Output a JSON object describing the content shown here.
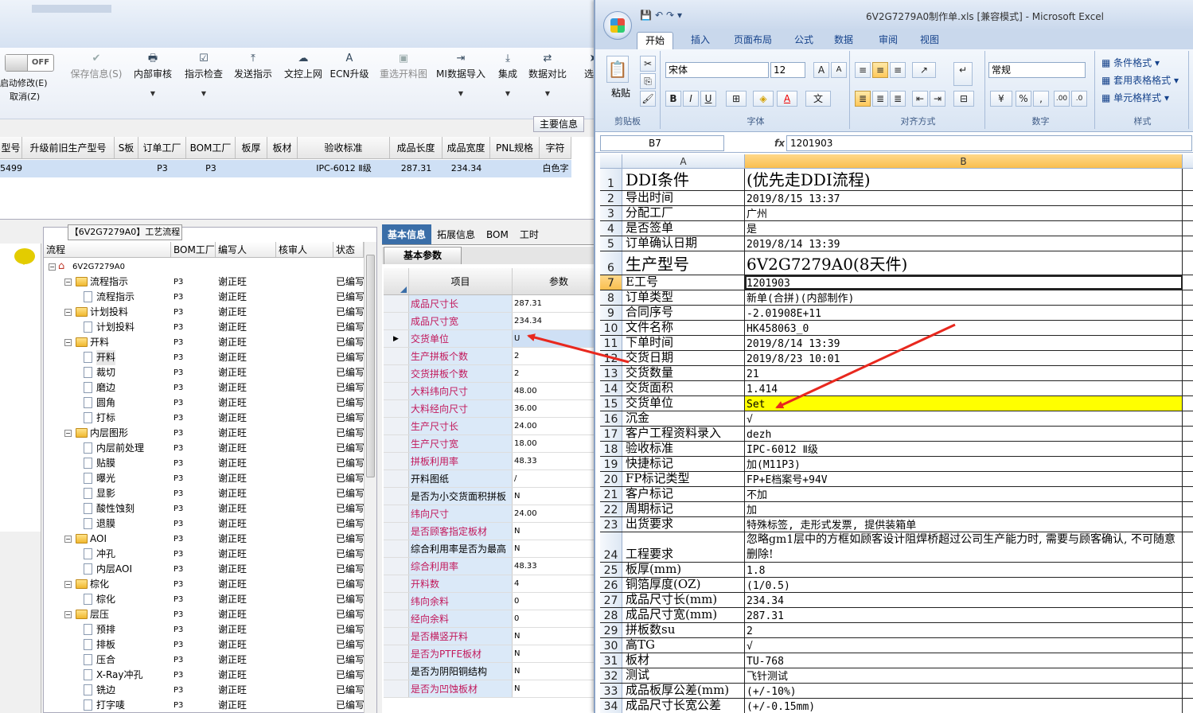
{
  "mes": {
    "toggle_label": "OFF",
    "start_modify": "启动修改(E)",
    "cancel": "取消(Z)",
    "toolbar": [
      {
        "label": "保存信息(S)",
        "icon": "check-icon",
        "disabled": true,
        "dd": false
      },
      {
        "label": "内部审核",
        "icon": "printer-icon",
        "disabled": false,
        "dd": true
      },
      {
        "label": "指示检查",
        "icon": "checkbox-icon",
        "disabled": false,
        "dd": true
      },
      {
        "label": "发送指示",
        "icon": "upload-icon",
        "disabled": false,
        "dd": false
      },
      {
        "label": "文控上网",
        "icon": "cloud-upload-icon",
        "disabled": false,
        "dd": false
      },
      {
        "label": "ECN升级",
        "icon": "a-letter-icon",
        "disabled": false,
        "dd": false
      },
      {
        "label": "重选开料图",
        "icon": "image-icon",
        "disabled": true,
        "dd": false
      },
      {
        "label": "MI数据导入",
        "icon": "import-icon",
        "disabled": false,
        "dd": true
      },
      {
        "label": "集成",
        "icon": "download-icon",
        "disabled": false,
        "dd": true
      },
      {
        "label": "数据对比",
        "icon": "compare-icon",
        "disabled": false,
        "dd": true
      },
      {
        "label": "选择",
        "icon": "arrow-icon",
        "disabled": false,
        "dd": false
      }
    ],
    "main_info_button": "主要信息",
    "grid_headers": [
      "型号",
      "升级前旧生产型号",
      "S板",
      "订单工厂",
      "BOM工厂",
      "板厚",
      "板材",
      "验收标准",
      "成品长度",
      "成品宽度",
      "PNL规格",
      "字符"
    ],
    "grid_row": [
      "5499",
      "",
      "",
      "P3",
      "P3",
      "",
      "",
      "IPC-6012 Ⅱ级",
      "287.31",
      "234.34",
      "",
      "白色字"
    ],
    "tree_title": "【6V2G7279A0】工艺流程",
    "tree_headers": [
      "流程",
      "BOM工厂",
      "编写人",
      "核审人",
      "状态"
    ],
    "tree_rows": [
      {
        "level": 0,
        "type": "home",
        "label": "6V2G7279A0",
        "factory": "",
        "author": "",
        "status": ""
      },
      {
        "level": 1,
        "type": "folder",
        "label": "流程指示",
        "factory": "P3",
        "author": "谢正旺",
        "status": "已编写"
      },
      {
        "level": 2,
        "type": "doc",
        "label": "流程指示",
        "factory": "P3",
        "author": "谢正旺",
        "status": "已编写"
      },
      {
        "level": 1,
        "type": "folder",
        "label": "计划投料",
        "factory": "P3",
        "author": "谢正旺",
        "status": "已编写"
      },
      {
        "level": 2,
        "type": "doc",
        "label": "计划投料",
        "factory": "P3",
        "author": "谢正旺",
        "status": "已编写"
      },
      {
        "level": 1,
        "type": "folder",
        "label": "开料",
        "factory": "P3",
        "author": "谢正旺",
        "status": "已编写"
      },
      {
        "level": 2,
        "type": "doc",
        "label": "开料",
        "factory": "P3",
        "author": "谢正旺",
        "status": "已编写",
        "selected": true
      },
      {
        "level": 2,
        "type": "doc",
        "label": "裁切",
        "factory": "P3",
        "author": "谢正旺",
        "status": "已编写"
      },
      {
        "level": 2,
        "type": "doc",
        "label": "磨边",
        "factory": "P3",
        "author": "谢正旺",
        "status": "已编写"
      },
      {
        "level": 2,
        "type": "doc",
        "label": "圆角",
        "factory": "P3",
        "author": "谢正旺",
        "status": "已编写"
      },
      {
        "level": 2,
        "type": "doc",
        "label": "打标",
        "factory": "P3",
        "author": "谢正旺",
        "status": "已编写"
      },
      {
        "level": 1,
        "type": "folder",
        "label": "内层图形",
        "factory": "P3",
        "author": "谢正旺",
        "status": "已编写"
      },
      {
        "level": 2,
        "type": "doc",
        "label": "内层前处理",
        "factory": "P3",
        "author": "谢正旺",
        "status": "已编写"
      },
      {
        "level": 2,
        "type": "doc",
        "label": "贴膜",
        "factory": "P3",
        "author": "谢正旺",
        "status": "已编写"
      },
      {
        "level": 2,
        "type": "doc",
        "label": "曝光",
        "factory": "P3",
        "author": "谢正旺",
        "status": "已编写"
      },
      {
        "level": 2,
        "type": "doc",
        "label": "显影",
        "factory": "P3",
        "author": "谢正旺",
        "status": "已编写"
      },
      {
        "level": 2,
        "type": "doc",
        "label": "酸性蚀刻",
        "factory": "P3",
        "author": "谢正旺",
        "status": "已编写"
      },
      {
        "level": 2,
        "type": "doc",
        "label": "退膜",
        "factory": "P3",
        "author": "谢正旺",
        "status": "已编写"
      },
      {
        "level": 1,
        "type": "folder",
        "label": "AOI",
        "factory": "P3",
        "author": "谢正旺",
        "status": "已编写"
      },
      {
        "level": 2,
        "type": "doc",
        "label": "冲孔",
        "factory": "P3",
        "author": "谢正旺",
        "status": "已编写"
      },
      {
        "level": 2,
        "type": "doc",
        "label": "内层AOI",
        "factory": "P3",
        "author": "谢正旺",
        "status": "已编写"
      },
      {
        "level": 1,
        "type": "folder",
        "label": "棕化",
        "factory": "P3",
        "author": "谢正旺",
        "status": "已编写"
      },
      {
        "level": 2,
        "type": "doc",
        "label": "棕化",
        "factory": "P3",
        "author": "谢正旺",
        "status": "已编写"
      },
      {
        "level": 1,
        "type": "folder",
        "label": "层压",
        "factory": "P3",
        "author": "谢正旺",
        "status": "已编写"
      },
      {
        "level": 2,
        "type": "doc",
        "label": "预排",
        "factory": "P3",
        "author": "谢正旺",
        "status": "已编写"
      },
      {
        "level": 2,
        "type": "doc",
        "label": "排板",
        "factory": "P3",
        "author": "谢正旺",
        "status": "已编写"
      },
      {
        "level": 2,
        "type": "doc",
        "label": "压合",
        "factory": "P3",
        "author": "谢正旺",
        "status": "已编写"
      },
      {
        "level": 2,
        "type": "doc",
        "label": "X-Ray冲孔",
        "factory": "P3",
        "author": "谢正旺",
        "status": "已编写"
      },
      {
        "level": 2,
        "type": "doc",
        "label": "铣边",
        "factory": "P3",
        "author": "谢正旺",
        "status": "已编写"
      },
      {
        "level": 2,
        "type": "doc",
        "label": "打字唛",
        "factory": "P3",
        "author": "谢正旺",
        "status": "已编写"
      }
    ],
    "param_tabs": [
      "基本信息",
      "拓展信息",
      "BOM",
      "工时"
    ],
    "param_subtab": "基本参数",
    "param_headers": {
      "name": "项目",
      "value": "参数"
    },
    "params": [
      {
        "name": "成品尺寸长",
        "value": "287.31",
        "mandatory": true
      },
      {
        "name": "成品尺寸宽",
        "value": "234.34",
        "mandatory": true
      },
      {
        "name": "交货单位",
        "value": "U",
        "mandatory": true,
        "current": true
      },
      {
        "name": "生产拼板个数",
        "value": "2",
        "mandatory": true
      },
      {
        "name": "交货拼板个数",
        "value": "2",
        "mandatory": true
      },
      {
        "name": "大料纬向尺寸",
        "value": "48.00",
        "mandatory": true
      },
      {
        "name": "大料经向尺寸",
        "value": "36.00",
        "mandatory": true
      },
      {
        "name": "生产尺寸长",
        "value": "24.00",
        "mandatory": true
      },
      {
        "name": "生产尺寸宽",
        "value": "18.00",
        "mandatory": true
      },
      {
        "name": "拼板利用率",
        "value": "48.33",
        "mandatory": true
      },
      {
        "name": "开料图纸",
        "value": "/",
        "mandatory": false
      },
      {
        "name": "是否为小交货面积拼板",
        "value": "N",
        "mandatory": false
      },
      {
        "name": "纬向尺寸",
        "value": "24.00",
        "mandatory": true
      },
      {
        "name": "是否顾客指定板材",
        "value": "N",
        "mandatory": true
      },
      {
        "name": "综合利用率是否为最高",
        "value": "N",
        "mandatory": false
      },
      {
        "name": "综合利用率",
        "value": "48.33",
        "mandatory": true
      },
      {
        "name": "开料数",
        "value": "4",
        "mandatory": true
      },
      {
        "name": "纬向余料",
        "value": "0",
        "mandatory": true
      },
      {
        "name": "经向余料",
        "value": "0",
        "mandatory": true
      },
      {
        "name": "是否横竖开料",
        "value": "N",
        "mandatory": true
      },
      {
        "name": "是否为PTFE板材",
        "value": "N",
        "mandatory": true
      },
      {
        "name": "是否为阴阳铜结构",
        "value": "N",
        "mandatory": false
      },
      {
        "name": "是否为凹蚀板材",
        "value": "N",
        "mandatory": true
      }
    ]
  },
  "excel": {
    "title": "6V2G7279A0制作单.xls [兼容模式] - Microsoft Excel",
    "tabs": [
      "开始",
      "插入",
      "页面布局",
      "公式",
      "数据",
      "审阅",
      "视图"
    ],
    "font_name": "宋体",
    "font_size": "12",
    "number_format": "常规",
    "paste_label": "粘贴",
    "group_labels": [
      "剪贴板",
      "字体",
      "对齐方式",
      "数字",
      "样式"
    ],
    "style_buttons": [
      "条件格式",
      "套用表格格式",
      "单元格样式"
    ],
    "name_box": "B7",
    "fx": "fx",
    "formula_value": "1201903",
    "col_a": "A",
    "col_b": "B",
    "rows": [
      {
        "n": "1",
        "a": "DDI条件",
        "b": "(优先走DDI流程)",
        "big": true
      },
      {
        "n": "2",
        "a": "导出时间",
        "b": "2019/8/15 13:37"
      },
      {
        "n": "3",
        "a": "分配工厂",
        "b": "广州"
      },
      {
        "n": "4",
        "a": "是否签单",
        "b": "是"
      },
      {
        "n": "5",
        "a": "订单确认日期",
        "b": "2019/8/14 13:39"
      },
      {
        "n": "6",
        "a": "生产型号",
        "b": "6V2G7279A0(8天件)",
        "big": true
      },
      {
        "n": "7",
        "a": "E工号",
        "b": "1201903",
        "sel": true
      },
      {
        "n": "8",
        "a": "订单类型",
        "b": "新单(合拼)(内部制作)"
      },
      {
        "n": "9",
        "a": "合同序号",
        "b": "-2.01908E+11"
      },
      {
        "n": "10",
        "a": "文件名称",
        "b": "HK458063_0"
      },
      {
        "n": "11",
        "a": "下单时间",
        "b": "2019/8/14 13:39"
      },
      {
        "n": "12",
        "a": "交货日期",
        "b": "2019/8/23 10:01"
      },
      {
        "n": "13",
        "a": "交货数量",
        "b": "21"
      },
      {
        "n": "14",
        "a": "交货面积",
        "b": "1.414"
      },
      {
        "n": "15",
        "a": "交货单位",
        "b": "Set",
        "yellow": true
      },
      {
        "n": "16",
        "a": "沉金",
        "b": "√"
      },
      {
        "n": "17",
        "a": "客户工程资料录入",
        "b": "dezh"
      },
      {
        "n": "18",
        "a": "验收标准",
        "b": "IPC-6012 Ⅱ级"
      },
      {
        "n": "19",
        "a": "快捷标记",
        "b": "加(M11P3)"
      },
      {
        "n": "20",
        "a": "FP标记类型",
        "b": "FP+E档案号+94V"
      },
      {
        "n": "21",
        "a": "客户标记",
        "b": "不加"
      },
      {
        "n": "22",
        "a": "周期标记",
        "b": "加"
      },
      {
        "n": "23",
        "a": "出货要求",
        "b": "特殊标签, 走形式发票, 提供装箱单"
      },
      {
        "n": "24",
        "a": "工程要求",
        "b": "忽略gm1层中的方框如顾客设计阻焊桥超过公司生产能力时, 需要与顾客确认, 不可随意删除!",
        "wrap": true
      },
      {
        "n": "25",
        "a": "板厚(mm)",
        "b": "1.8"
      },
      {
        "n": "26",
        "a": "铜箔厚度(OZ)",
        "b": "(1/0.5)"
      },
      {
        "n": "27",
        "a": "成品尺寸长(mm)",
        "b": "234.34"
      },
      {
        "n": "28",
        "a": "成品尺寸宽(mm)",
        "b": "287.31"
      },
      {
        "n": "29",
        "a": "拼板数su",
        "b": "2"
      },
      {
        "n": "30",
        "a": "高TG",
        "b": "√"
      },
      {
        "n": "31",
        "a": "板材",
        "b": "TU-768"
      },
      {
        "n": "32",
        "a": "测试",
        "b": "飞针测试"
      },
      {
        "n": "33",
        "a": "成品板厚公差(mm)",
        "b": "(+/-10%)"
      },
      {
        "n": "34",
        "a": "成品尺寸长宽公差",
        "b": "(+/-0.15mm)"
      }
    ]
  },
  "colors": {
    "arrow": "#e8281e",
    "highlight": "#ffff00",
    "mandatory_text": "#c2185b",
    "tab_active": "#3a6ea8"
  }
}
